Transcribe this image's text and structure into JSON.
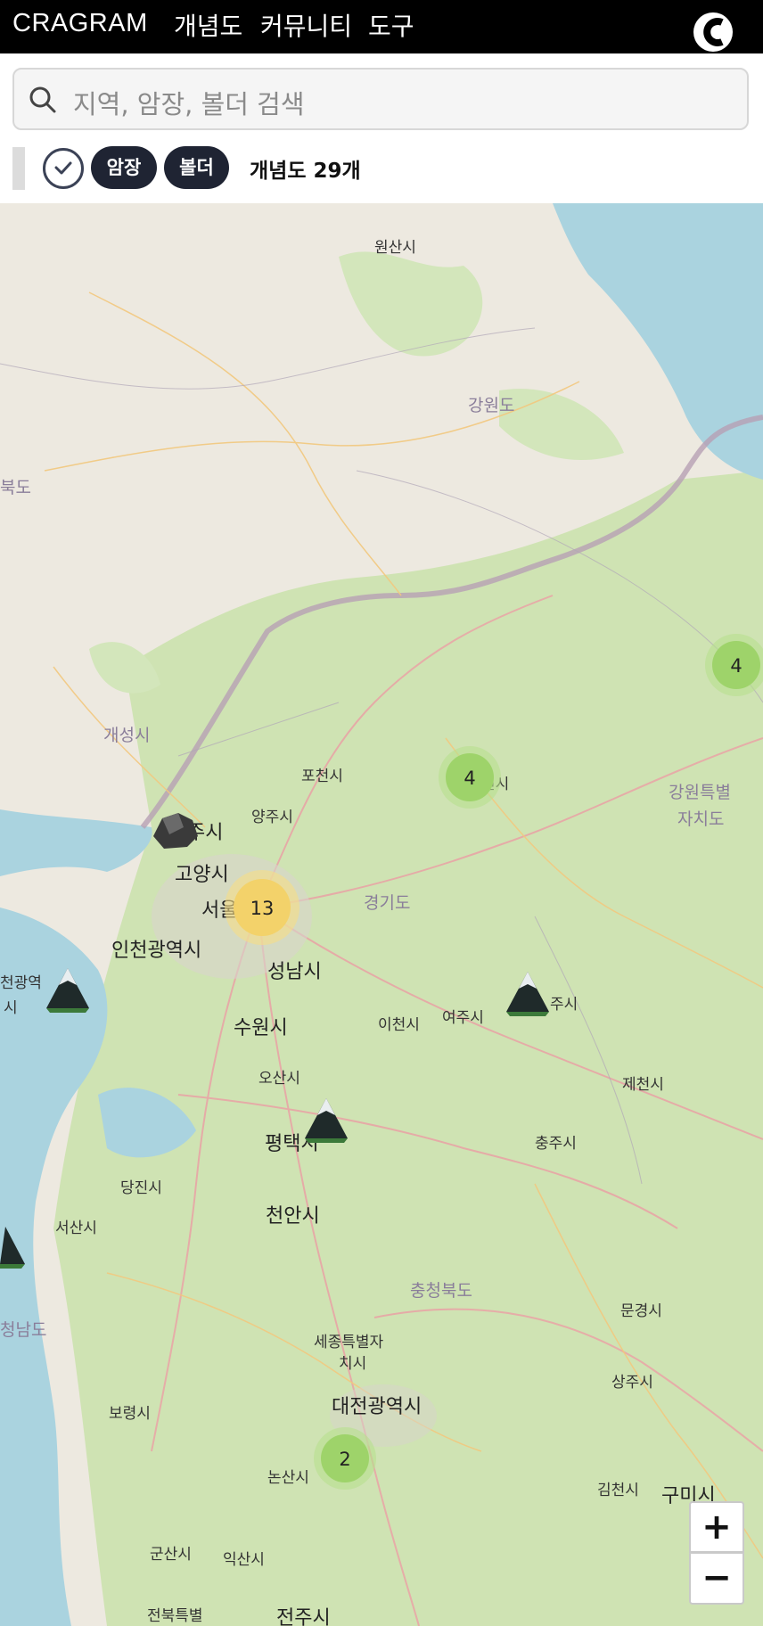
{
  "header": {
    "brand": "CRAGRAM",
    "nav": [
      "개념도",
      "커뮤니티",
      "도구"
    ],
    "logo_icon": "c-logo-icon"
  },
  "search": {
    "placeholder": "지역, 암장, 볼더 검색",
    "icon": "search-icon"
  },
  "filters": {
    "toggle_icon": "check-circle-icon",
    "chips": [
      "암장",
      "볼더"
    ],
    "count_text": "개념도 29개"
  },
  "map": {
    "labels": [
      {
        "text": "원산시",
        "kind": "city"
      },
      {
        "text": "강원도",
        "kind": "province"
      },
      {
        "text": "북도",
        "kind": "province"
      },
      {
        "text": "개성시",
        "kind": "province"
      },
      {
        "text": "포천시",
        "kind": "city"
      },
      {
        "text": "양주시",
        "kind": "city"
      },
      {
        "text": "주시",
        "kind": "city"
      },
      {
        "text": "고양시",
        "kind": "big"
      },
      {
        "text": "서울시",
        "kind": "big"
      },
      {
        "text": "경기도",
        "kind": "province"
      },
      {
        "text": "인천광역시",
        "kind": "big"
      },
      {
        "text": "천광역",
        "kind": "city"
      },
      {
        "text": "시",
        "kind": "city"
      },
      {
        "text": "성남시",
        "kind": "big"
      },
      {
        "text": "수원시",
        "kind": "big"
      },
      {
        "text": "이천시",
        "kind": "city"
      },
      {
        "text": "여주시",
        "kind": "city"
      },
      {
        "text": "주시",
        "kind": "city"
      },
      {
        "text": "오산시",
        "kind": "city"
      },
      {
        "text": "평택시",
        "kind": "big"
      },
      {
        "text": "제천시",
        "kind": "city"
      },
      {
        "text": "충주시",
        "kind": "city"
      },
      {
        "text": "당진시",
        "kind": "city"
      },
      {
        "text": "서산시",
        "kind": "city"
      },
      {
        "text": "천안시",
        "kind": "big"
      },
      {
        "text": "충청북도",
        "kind": "province"
      },
      {
        "text": "청남도",
        "kind": "province"
      },
      {
        "text": "세종특별자",
        "kind": "city"
      },
      {
        "text": "치시",
        "kind": "city"
      },
      {
        "text": "문경시",
        "kind": "city"
      },
      {
        "text": "대전광역시",
        "kind": "big"
      },
      {
        "text": "보령시",
        "kind": "city"
      },
      {
        "text": "상주시",
        "kind": "city"
      },
      {
        "text": "논산시",
        "kind": "city"
      },
      {
        "text": "김천시",
        "kind": "city"
      },
      {
        "text": "구미시",
        "kind": "big"
      },
      {
        "text": "군산시",
        "kind": "city"
      },
      {
        "text": "익산시",
        "kind": "city"
      },
      {
        "text": "전북특별",
        "kind": "city"
      },
      {
        "text": "전주시",
        "kind": "big"
      },
      {
        "text": "강원특별",
        "kind": "province"
      },
      {
        "text": "자치도",
        "kind": "province"
      },
      {
        "text": "천시",
        "kind": "city"
      }
    ],
    "clusters": [
      {
        "count": "4",
        "color": "#9ed36a"
      },
      {
        "count": "4",
        "color": "#9ed36a"
      },
      {
        "count": "13",
        "color": "#f3d26a"
      },
      {
        "count": "2",
        "color": "#9ed36a"
      }
    ],
    "markers": [
      {
        "icon": "boulder-icon"
      },
      {
        "icon": "mountain-icon"
      },
      {
        "icon": "mountain-icon"
      },
      {
        "icon": "mountain-icon"
      },
      {
        "icon": "mountain-icon"
      }
    ],
    "zoom_in": "+",
    "zoom_out": "−"
  }
}
